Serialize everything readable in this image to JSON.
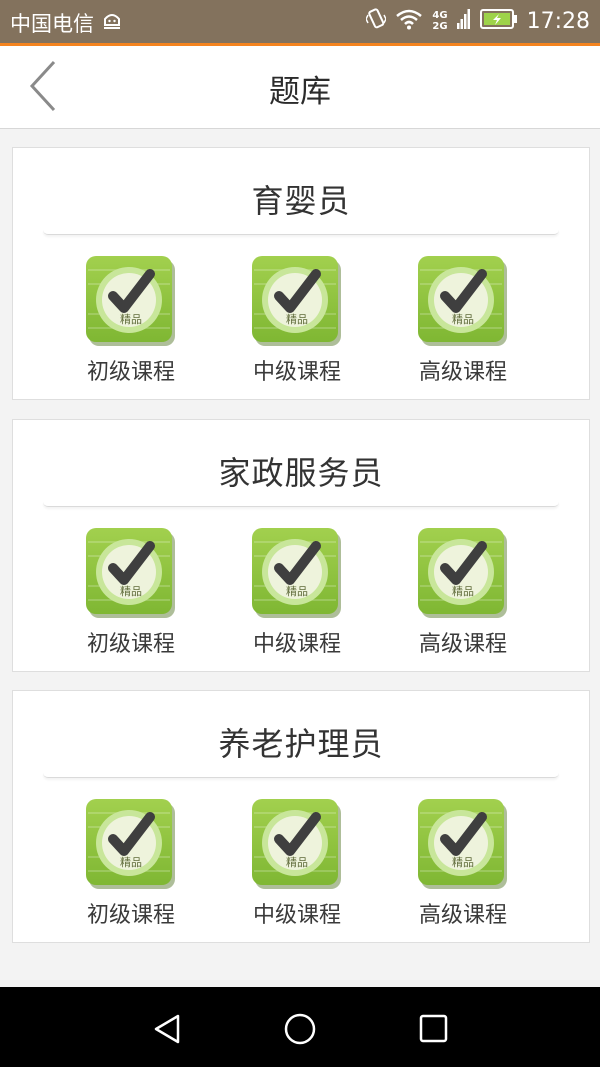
{
  "status_bar": {
    "carrier": "中国电信",
    "network_top": "4G",
    "network_bottom": "2G",
    "time": "17:28"
  },
  "header": {
    "title": "题库",
    "back_icon": "chevron-left-icon"
  },
  "badge_label": "精品",
  "sections": [
    {
      "title": "育婴员",
      "courses": [
        {
          "label": "初级课程"
        },
        {
          "label": "中级课程"
        },
        {
          "label": "高级课程"
        }
      ]
    },
    {
      "title": "家政服务员",
      "courses": [
        {
          "label": "初级课程"
        },
        {
          "label": "中级课程"
        },
        {
          "label": "高级课程"
        }
      ]
    },
    {
      "title": "养老护理员",
      "courses": [
        {
          "label": "初级课程"
        },
        {
          "label": "中级课程"
        },
        {
          "label": "高级课程"
        }
      ]
    }
  ],
  "colors": {
    "status_bar": "#83725d",
    "accent": "#f5841f",
    "icon_green": "#8cc63f",
    "check_dark": "#4a4a4a"
  }
}
